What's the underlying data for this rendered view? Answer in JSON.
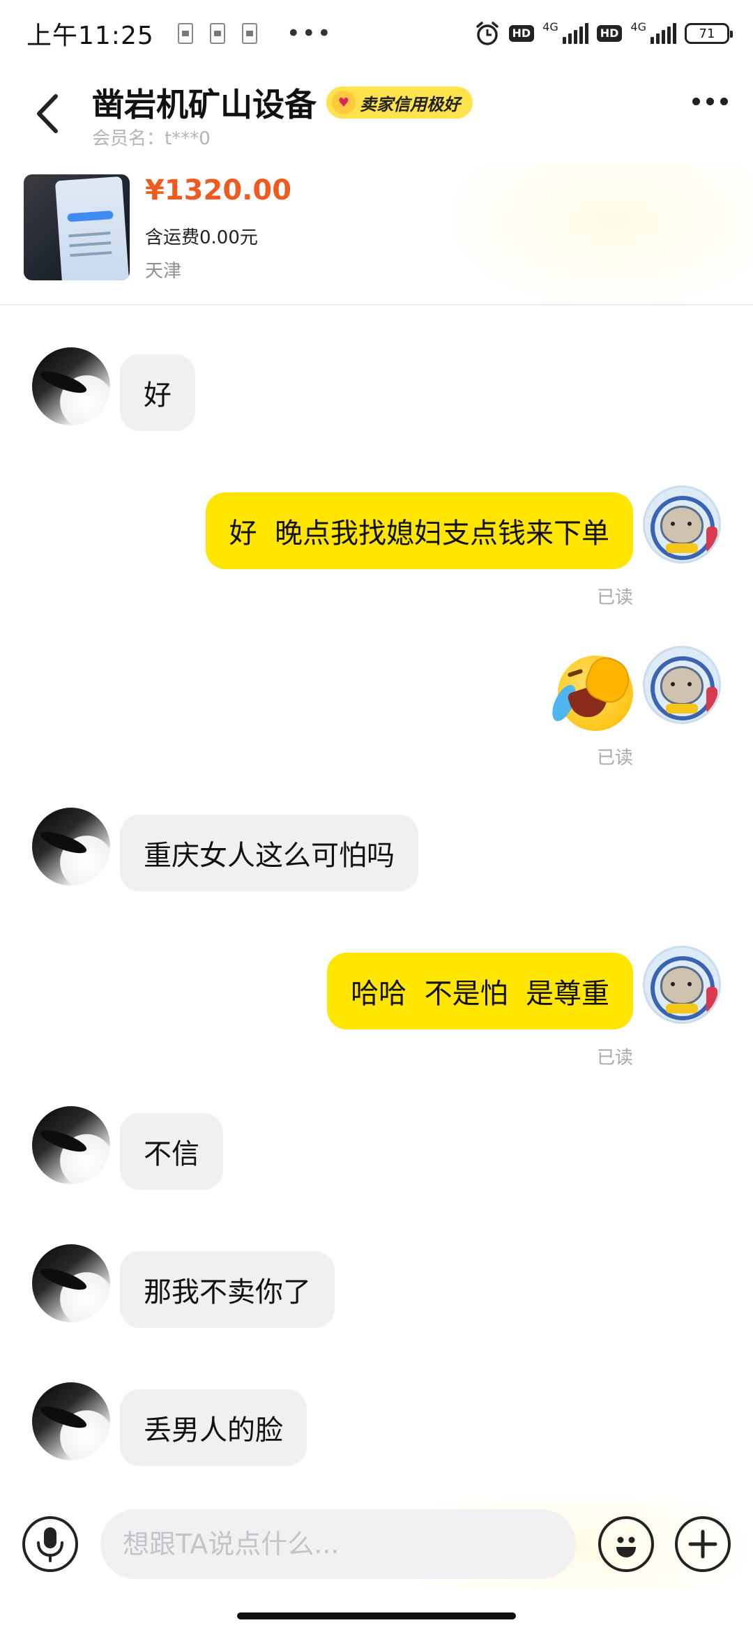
{
  "status_bar": {
    "time": "上午11:25",
    "more": "•••",
    "network_1": "4G",
    "network_2": "4G",
    "hd": "HD",
    "battery": "71"
  },
  "header": {
    "title": "凿岩机矿山设备",
    "credit_badge": "卖家信用极好",
    "member_label": "会员名：t***0"
  },
  "product": {
    "price": "¥1320.00",
    "shipping": "含运费0.00元",
    "location": "天津"
  },
  "messages": [
    {
      "from": "seller",
      "text": "好"
    },
    {
      "from": "me",
      "text": "好  晚点我找媳妇支点钱来下单",
      "status": "已读"
    },
    {
      "from": "me",
      "type": "sticker",
      "sticker": "crying-laughing-face-emoji",
      "status": "已读"
    },
    {
      "from": "seller",
      "text": "重庆女人这么可怕吗"
    },
    {
      "from": "me",
      "text": "哈哈  不是怕  是尊重",
      "status": "已读"
    },
    {
      "from": "seller",
      "text": "不信"
    },
    {
      "from": "seller",
      "text": "那我不卖你了"
    },
    {
      "from": "seller",
      "text": "丢男人的脸"
    }
  ],
  "input_bar": {
    "placeholder": "想跟TA说点什么...",
    "icons": [
      "microphone-icon",
      "emoji-icon",
      "plus-icon"
    ]
  }
}
